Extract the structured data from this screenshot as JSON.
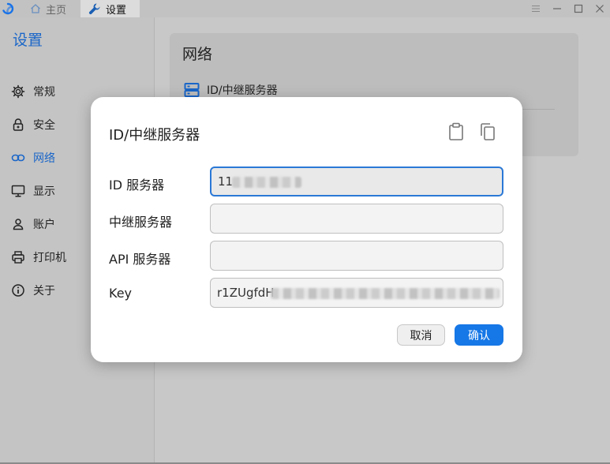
{
  "titlebar": {
    "tabs": [
      {
        "label": "主页",
        "icon": "home-icon"
      },
      {
        "label": "设置",
        "icon": "wrench-icon"
      }
    ],
    "controls": [
      "menu-icon",
      "minimize-icon",
      "maximize-icon",
      "close-icon"
    ]
  },
  "sidebar": {
    "title": "设置",
    "items": [
      {
        "label": "常规",
        "icon": "gear-icon"
      },
      {
        "label": "安全",
        "icon": "lock-icon"
      },
      {
        "label": "网络",
        "icon": "link-icon",
        "active": true
      },
      {
        "label": "显示",
        "icon": "monitor-icon"
      },
      {
        "label": "账户",
        "icon": "person-icon"
      },
      {
        "label": "打印机",
        "icon": "printer-icon"
      },
      {
        "label": "关于",
        "icon": "info-icon"
      }
    ]
  },
  "content": {
    "card_title": "网络",
    "row_label": "ID/中继服务器"
  },
  "dialog": {
    "title": "ID/中继服务器",
    "fields": [
      {
        "label": "ID 服务器",
        "value": "11"
      },
      {
        "label": "中继服务器",
        "value": ""
      },
      {
        "label": "API 服务器",
        "value": ""
      },
      {
        "label": "Key",
        "value": "r1ZUgfdH"
      }
    ],
    "cancel_label": "取消",
    "ok_label": "确认"
  },
  "colors": {
    "accent": "#1a66c8",
    "primary_button": "#1677e6",
    "focus_border": "#2a78d6"
  }
}
